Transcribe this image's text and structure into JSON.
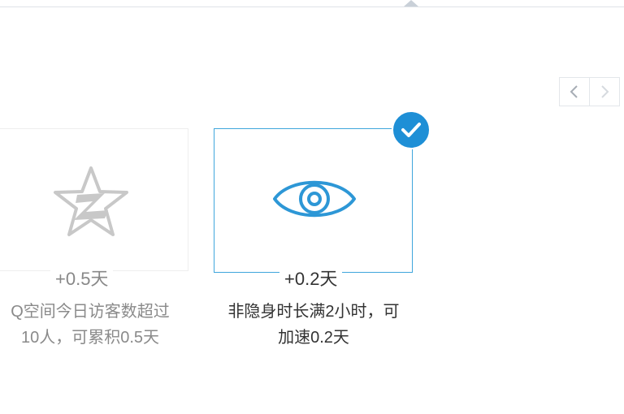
{
  "header": {
    "caret_icon": "caret-up-icon"
  },
  "pager": {
    "prev_icon": "chevron-left-icon",
    "next_icon": "chevron-right-icon"
  },
  "cards": [
    {
      "icon": "qzone-star-icon",
      "bonus": "+0.5天",
      "desc_line1": "Q空间今日访客数超过",
      "desc_line2": "10人，可累积0.5天",
      "selected": false
    },
    {
      "icon": "eye-icon",
      "bonus": "+0.2天",
      "desc_line1": "非隐身时长满2小时，可",
      "desc_line2": "加速0.2天",
      "selected": true,
      "selected_icon": "checkmark-icon"
    }
  ],
  "colors": {
    "accent": "#1e8fd6",
    "selected_border": "#3fa6dc",
    "muted_text": "#888888",
    "body_text": "#333333"
  }
}
